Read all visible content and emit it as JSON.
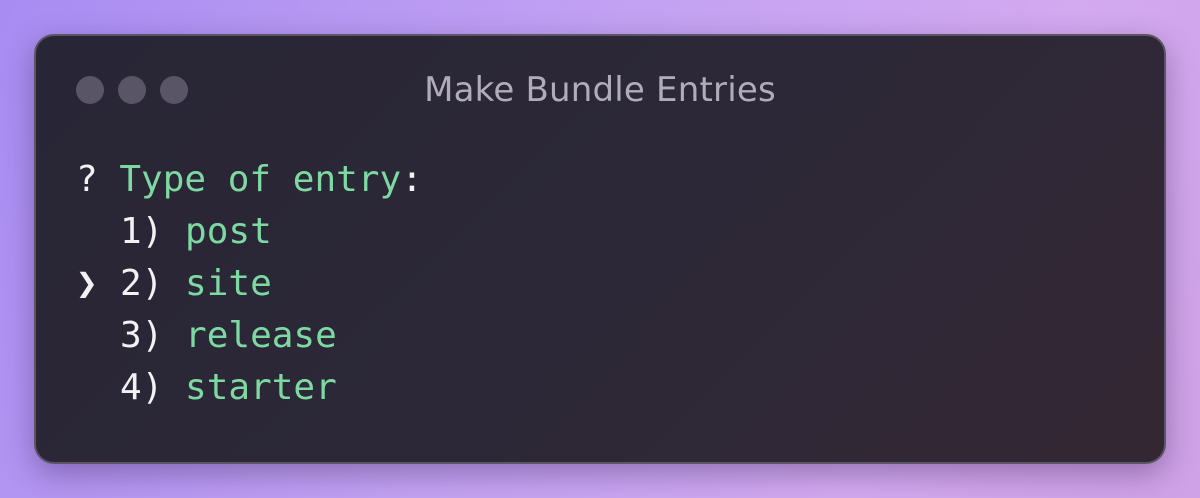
{
  "window": {
    "title": "Make Bundle Entries"
  },
  "terminal": {
    "prompt_symbol": "?",
    "question": "Type of entry",
    "question_suffix": ":",
    "pointer_symbol": "❯",
    "selected_index": 1,
    "options": [
      {
        "number": "1)",
        "label": "post"
      },
      {
        "number": "2)",
        "label": "site"
      },
      {
        "number": "3)",
        "label": "release"
      },
      {
        "number": "4)",
        "label": "starter"
      }
    ]
  },
  "colors": {
    "prompt_green": "#7dd9a1",
    "text_white": "#f2f2f5",
    "title_gray": "#b0acb9",
    "traffic_light_gray": "#595566"
  }
}
